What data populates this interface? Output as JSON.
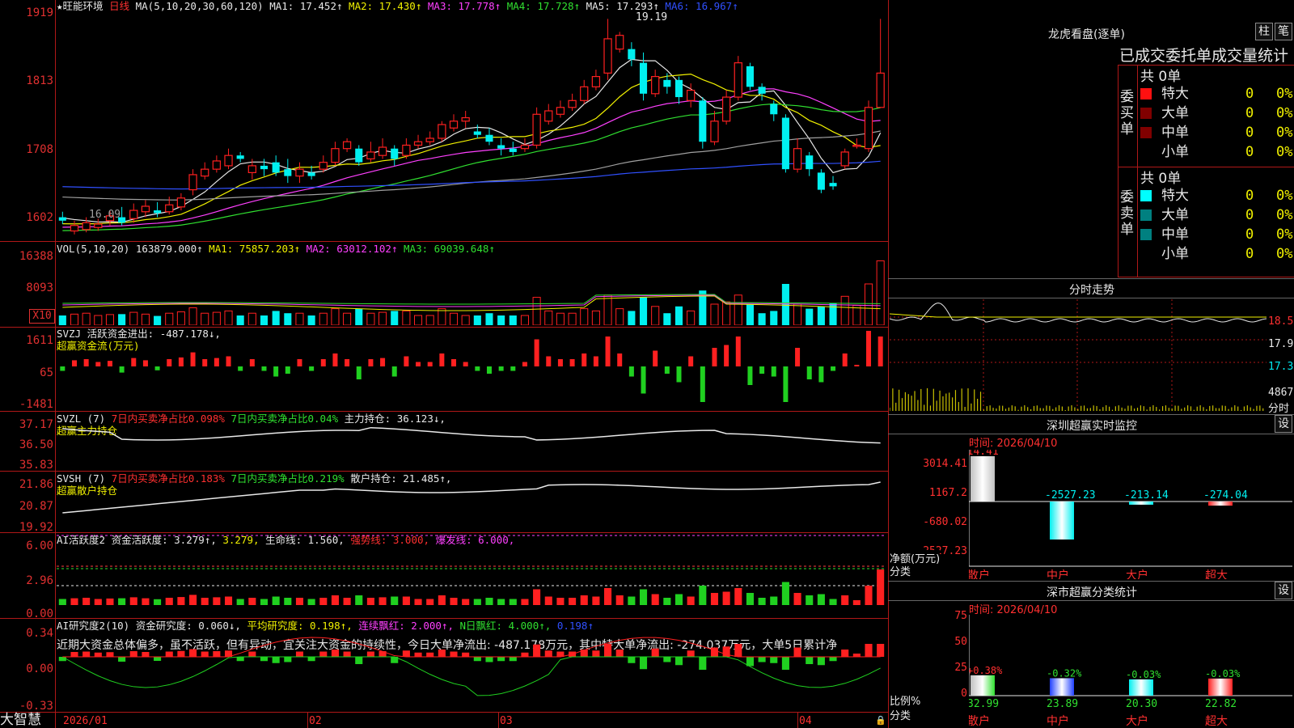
{
  "colors": {
    "up": "#ff2020",
    "down": "#00f0f0",
    "ma1": "#e8e8e8",
    "ma2": "#f0f000",
    "ma3": "#ff40ff",
    "ma4": "#30e030",
    "ma5": "#a0a0a0",
    "ma6": "#3050ff",
    "frame": "#b01818"
  },
  "main": {
    "title_star": "★",
    "stock_name": "旺能环境",
    "period": "日线",
    "ma_label": "MA(5,10,20,30,60,120)",
    "ma1": "MA1: 17.452↑",
    "ma2": "MA2: 17.430↑",
    "ma3": "MA3: 17.778↑",
    "ma4": "MA4: 17.728↑",
    "ma5": "MA5: 17.293↑",
    "ma6": "MA6: 16.967↑",
    "high_label": "19.19",
    "low_label": "16.09",
    "y_ticks": [
      "1919",
      "1813",
      "1708",
      "1602"
    ],
    "candles": [
      [
        16.3,
        16.25,
        16.38,
        16.2
      ],
      [
        16.1,
        16.18,
        16.25,
        16.05
      ],
      [
        16.12,
        16.22,
        16.3,
        16.08
      ],
      [
        16.15,
        16.2,
        16.28,
        16.1
      ],
      [
        16.25,
        16.32,
        16.4,
        16.18
      ],
      [
        16.3,
        16.22,
        16.45,
        16.18
      ],
      [
        16.28,
        16.4,
        16.5,
        16.22
      ],
      [
        16.38,
        16.46,
        16.55,
        16.3
      ],
      [
        16.4,
        16.36,
        16.52,
        16.3
      ],
      [
        16.38,
        16.48,
        16.6,
        16.34
      ],
      [
        16.45,
        16.58,
        16.65,
        16.4
      ],
      [
        16.7,
        16.92,
        17.0,
        16.62
      ],
      [
        16.9,
        17.0,
        17.1,
        16.85
      ],
      [
        17.0,
        17.12,
        17.2,
        16.95
      ],
      [
        17.05,
        17.2,
        17.3,
        17.0
      ],
      [
        17.2,
        17.15,
        17.25,
        17.1
      ],
      [
        16.95,
        17.05,
        17.15,
        16.85
      ],
      [
        17.05,
        17.0,
        17.15,
        16.9
      ],
      [
        17.1,
        16.95,
        17.2,
        16.9
      ],
      [
        17.0,
        16.9,
        17.15,
        16.8
      ],
      [
        16.9,
        17.0,
        17.1,
        16.8
      ],
      [
        16.95,
        16.9,
        17.05,
        16.85
      ],
      [
        17.0,
        17.1,
        17.2,
        16.95
      ],
      [
        17.1,
        17.3,
        17.4,
        17.05
      ],
      [
        17.3,
        17.4,
        17.45,
        17.25
      ],
      [
        17.3,
        17.1,
        17.35,
        17.05
      ],
      [
        17.15,
        17.25,
        17.4,
        17.1
      ],
      [
        17.2,
        17.32,
        17.45,
        17.15
      ],
      [
        17.3,
        17.15,
        17.35,
        17.05
      ],
      [
        17.2,
        17.35,
        17.45,
        17.15
      ],
      [
        17.35,
        17.4,
        17.5,
        17.3
      ],
      [
        17.4,
        17.45,
        17.55,
        17.35
      ],
      [
        17.45,
        17.65,
        17.7,
        17.4
      ],
      [
        17.6,
        17.7,
        17.8,
        17.55
      ],
      [
        17.7,
        17.75,
        17.85,
        17.6
      ],
      [
        17.55,
        17.5,
        17.65,
        17.45
      ],
      [
        17.5,
        17.4,
        17.6,
        17.35
      ],
      [
        17.35,
        17.3,
        17.45,
        17.2
      ],
      [
        17.3,
        17.25,
        17.4,
        17.2
      ],
      [
        17.3,
        17.35,
        17.45,
        17.25
      ],
      [
        17.35,
        17.8,
        17.9,
        17.3
      ],
      [
        17.7,
        17.85,
        17.95,
        17.65
      ],
      [
        17.8,
        17.9,
        18.0,
        17.75
      ],
      [
        17.9,
        18.0,
        18.1,
        17.85
      ],
      [
        18.0,
        18.2,
        18.3,
        17.95
      ],
      [
        18.2,
        18.35,
        18.45,
        18.15
      ],
      [
        18.4,
        18.9,
        19.19,
        18.3
      ],
      [
        18.75,
        18.95,
        19.0,
        18.7
      ],
      [
        18.75,
        18.6,
        18.85,
        18.5
      ],
      [
        18.55,
        18.1,
        18.7,
        18.0
      ],
      [
        18.1,
        18.35,
        18.45,
        18.05
      ],
      [
        18.3,
        18.2,
        18.4,
        18.1
      ],
      [
        18.3,
        18.05,
        18.35,
        17.95
      ],
      [
        18.0,
        18.15,
        18.25,
        17.9
      ],
      [
        18.0,
        17.4,
        18.05,
        17.3
      ],
      [
        17.4,
        17.7,
        17.85,
        17.35
      ],
      [
        17.7,
        18.05,
        18.15,
        17.65
      ],
      [
        18.05,
        18.55,
        18.65,
        18.0
      ],
      [
        18.5,
        18.2,
        18.55,
        18.15
      ],
      [
        18.2,
        18.1,
        18.25,
        18.0
      ],
      [
        17.95,
        17.8,
        18.0,
        17.7
      ],
      [
        17.75,
        17.0,
        17.8,
        16.95
      ],
      [
        17.0,
        17.3,
        17.45,
        16.95
      ],
      [
        17.2,
        17.0,
        17.25,
        16.9
      ],
      [
        16.95,
        16.7,
        17.0,
        16.65
      ],
      [
        16.8,
        16.75,
        16.9,
        16.7
      ],
      [
        17.05,
        17.25,
        17.3,
        17.0
      ],
      [
        17.35,
        17.35,
        17.45,
        17.3
      ],
      [
        17.3,
        17.9,
        18.0,
        17.25
      ],
      [
        17.9,
        18.4,
        19.19,
        17.9
      ]
    ],
    "x_labels": [
      "2026/01",
      "02",
      "03",
      "04"
    ]
  },
  "vol": {
    "label": "VOL(5,10,20)",
    "value": "163879.000↑",
    "ma1": "MA1: 75857.203↑",
    "ma2": "MA2: 63012.102↑",
    "ma3": "MA3: 69039.648↑",
    "y_ticks": [
      "16388",
      "8093"
    ],
    "unit": "X10"
  },
  "svzj": {
    "label": "SVZJ",
    "label2": "活跃资金进出: -487.178↓,",
    "sub": "超赢资金流(万元)",
    "y_ticks": [
      "1611",
      "65",
      "-1481"
    ]
  },
  "svzl": {
    "label": "SVZL (7)",
    "t1": "7日内买卖净占比0.098%",
    "t2": "7日内买卖净占比0.04%",
    "t3": "主力持仓: 36.123↓,",
    "sub": "超赢主力持仓",
    "y_ticks": [
      "37.17",
      "36.50",
      "35.83"
    ]
  },
  "svsh": {
    "label": "SVSH (7)",
    "t1": "7日内买卖净占比0.183%",
    "t2": "7日内买卖净占比0.219%",
    "t3": "散户持仓: 21.485↑,",
    "sub": "超赢散户持仓",
    "y_ticks": [
      "21.86",
      "20.87",
      "19.92"
    ]
  },
  "ai1": {
    "label": "AI活跃度2",
    "t1": "资金活跃度: 3.279↑,",
    "t2": "3.279,",
    "t3": "生命线: 1.560,",
    "t4": "强势线: 3.000,",
    "t5": "爆发线: 6.000,",
    "y_ticks": [
      "6.00",
      "2.96",
      "0.00"
    ]
  },
  "ai2": {
    "label": "AI研究度2(10)",
    "t1": "资金研究度: 0.060↓,",
    "t2": "平均研究度: 0.198↑,",
    "t3": "连续飘红: 2.000↑,",
    "t4": "N日飘红: 4.000↑,",
    "t5": "0.198↑",
    "text": "近期大资金总体偏多，虽不活跃，但有异动，宜关注大资金的持续性，今日大单净流出: -487.178万元，其中特大单净流出: -274.037万元，大单5日累计净",
    "y_ticks": [
      "0.34",
      "0.00",
      "-0.33"
    ]
  },
  "bottom": {
    "brand": "大智慧"
  },
  "lhb": {
    "title": "龙虎看盘(逐单)",
    "btn1": "柱",
    "btn2": "笔",
    "header": "已成交委托单成交量统计",
    "buy": {
      "title": "委买单",
      "count": "共 0单",
      "rows": [
        {
          "label": "特大",
          "v": "0",
          "p": "0%",
          "color": "#ff1010"
        },
        {
          "label": "大单",
          "v": "0",
          "p": "0%",
          "color": "#800000"
        },
        {
          "label": "中单",
          "v": "0",
          "p": "0%",
          "color": "#800000"
        },
        {
          "label": "小单",
          "v": "0",
          "p": "0%",
          "color": ""
        }
      ]
    },
    "sell": {
      "title": "委卖单",
      "count": "共 0单",
      "rows": [
        {
          "label": "特大",
          "v": "0",
          "p": "0%",
          "color": "#00ffff"
        },
        {
          "label": "大单",
          "v": "0",
          "p": "0%",
          "color": "#008080"
        },
        {
          "label": "中单",
          "v": "0",
          "p": "0%",
          "color": "#008080"
        },
        {
          "label": "小单",
          "v": "0",
          "p": "0%",
          "color": ""
        }
      ]
    }
  },
  "fenshi": {
    "title": "分时走势",
    "y_ticks": [
      "18.53",
      "17.93",
      "17.33",
      "4867",
      "分时"
    ]
  },
  "monitor": {
    "title": "深圳超赢实时监控",
    "set": "设",
    "time": "时间: 2026/04/10",
    "y_ticks": [
      "3014.41",
      "1167.2",
      "-680.02",
      "-2527.23"
    ],
    "axis_title": "净额(万元)",
    "axis_title2": "分类",
    "bars": [
      {
        "cat": "散户",
        "value": 3014.41,
        "label": "3014.41"
      },
      {
        "cat": "中户",
        "value": -2527.23,
        "label": "-2527.23"
      },
      {
        "cat": "大户",
        "value": -213.14,
        "label": "-213.14"
      },
      {
        "cat": "超大",
        "value": -274.04,
        "label": "-274.04"
      }
    ]
  },
  "classify": {
    "title": "深市超赢分类统计",
    "set": "设",
    "time": "时间: 2026/04/10",
    "y_ticks": [
      "75",
      "50",
      "25",
      "0"
    ],
    "axis_title": "比例%",
    "axis_title2": "分类",
    "bars": [
      {
        "cat": "散户",
        "value": 32.99,
        "label": "32.99",
        "chg": "+0.38%",
        "color": "#c0c0c0",
        "color2": "#30e030"
      },
      {
        "cat": "中户",
        "value": 23.89,
        "label": "23.89",
        "chg": "-0.32%",
        "color": "#2040ff",
        "color2": "#2040ff"
      },
      {
        "cat": "大户",
        "value": 20.3,
        "label": "20.30",
        "chg": "-0.03%",
        "color": "#00f0f0",
        "color2": "#00f0f0"
      },
      {
        "cat": "超大",
        "value": 22.82,
        "label": "22.82",
        "chg": "-0.03%",
        "color": "#ff2020",
        "color2": "#ff2020"
      }
    ]
  }
}
